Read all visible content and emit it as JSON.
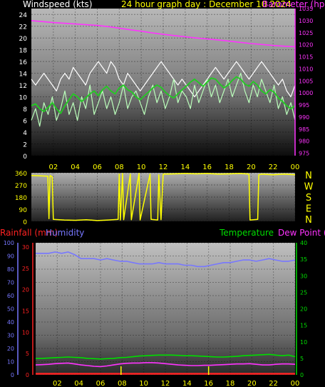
{
  "header": {
    "wind_title": "Windspeed (kts)",
    "graph_title": "24 hour graph day : December 10 2024",
    "baro_title": "Barometer (hpa)"
  },
  "colors": {
    "wind_text": "#ffffff",
    "baro": "#ff33ff",
    "gust": "#ffffff",
    "speed": "#bbffbb",
    "avg": "#22cc22",
    "direction": "#ffff00",
    "rain": "#ff2222",
    "humidity": "#7777ff",
    "temp": "#00dd00",
    "dewpoint": "#ff33ff"
  },
  "chart_data": [
    {
      "type": "line",
      "id": "wind_baro",
      "x_ticks": [
        "02",
        "04",
        "06",
        "08",
        "10",
        "12",
        "14",
        "16",
        "18",
        "20",
        "22",
        "00"
      ],
      "ylabel_left": "Windspeed (kts)",
      "ylabel_right": "Barometer (hpa)",
      "ylim_left": [
        0,
        25
      ],
      "left_ticks": [
        0,
        2,
        4,
        6,
        8,
        10,
        12,
        14,
        16,
        18,
        20,
        22,
        24
      ],
      "ylim_right": [
        974,
        1035
      ],
      "right_ticks": [
        975,
        980,
        985,
        990,
        995,
        1000,
        1005,
        1010,
        1015,
        1020,
        1025,
        1030,
        1035
      ],
      "series": [
        {
          "name": "Barometer (hpa)",
          "axis": "right",
          "values": [
            1030.0,
            1029.6,
            1029.2,
            1028.9,
            1028.6,
            1028.3,
            1028.0,
            1027.5,
            1026.9,
            1026.2,
            1025.6,
            1024.9,
            1024.3,
            1023.8,
            1023.3,
            1022.8,
            1022.4,
            1022.0,
            1021.5,
            1021.0,
            1020.5,
            1020.1,
            1019.7,
            1019.4,
            1019.2
          ]
        },
        {
          "name": "gust",
          "axis": "left",
          "values": [
            13,
            12,
            13,
            14,
            13,
            12,
            11,
            13,
            14,
            13,
            15,
            14,
            13,
            12,
            14,
            15,
            16,
            15,
            14,
            16,
            15,
            13,
            12,
            14,
            13,
            12,
            11,
            12,
            13,
            14,
            15,
            16,
            15,
            14,
            13,
            12,
            13,
            12,
            11,
            10,
            11,
            12,
            13,
            14,
            15,
            14,
            13,
            14,
            15,
            16,
            15,
            14,
            13,
            14,
            15,
            16,
            15,
            14,
            13,
            12,
            13,
            11,
            10,
            12
          ]
        },
        {
          "name": "speed",
          "axis": "left",
          "values": [
            6,
            8,
            5,
            9,
            7,
            10,
            6,
            8,
            11,
            7,
            9,
            6,
            10,
            8,
            12,
            7,
            9,
            11,
            8,
            10,
            7,
            9,
            12,
            8,
            10,
            11,
            9,
            7,
            10,
            12,
            9,
            11,
            8,
            10,
            13,
            9,
            11,
            10,
            8,
            12,
            9,
            11,
            13,
            10,
            12,
            9,
            11,
            13,
            10,
            12,
            14,
            11,
            9,
            12,
            10,
            13,
            11,
            9,
            12,
            8,
            10,
            7,
            9,
            6
          ]
        },
        {
          "name": "average",
          "axis": "left",
          "values": [
            8.5,
            8.8,
            8.0,
            7.5,
            8.2,
            9.0,
            8.0,
            7.2,
            8.5,
            9.5,
            10.5,
            10.0,
            9.2,
            9.8,
            10.5,
            11.0,
            10.2,
            11.2,
            11.8,
            11.0,
            10.5,
            11.5,
            12.0,
            11.2,
            10.8,
            10.0,
            9.5,
            10.2,
            10.8,
            11.5,
            12.0,
            11.6,
            10.8,
            10.2,
            9.8,
            10.5,
            11.2,
            11.8,
            12.5,
            13.0,
            12.4,
            11.8,
            12.5,
            13.2,
            13.0,
            12.2,
            11.5,
            12.0,
            12.8,
            13.4,
            13.0,
            12.2,
            11.8,
            12.6,
            12.0,
            11.0,
            10.5,
            11.2,
            10.8,
            9.8,
            9.2,
            8.5,
            8.0,
            8.5
          ]
        }
      ]
    },
    {
      "type": "line",
      "id": "direction",
      "x_ticks": [
        "02",
        "04",
        "06",
        "08",
        "10",
        "12",
        "14",
        "16",
        "18",
        "20",
        "22",
        "00"
      ],
      "ylim": [
        0,
        360
      ],
      "left_ticks": [
        0,
        90,
        180,
        270,
        360
      ],
      "compass_labels": [
        "N",
        "W",
        "S",
        "E",
        "N"
      ],
      "series": [
        {
          "name": "direction",
          "points": [
            [
              0,
              340
            ],
            [
              1.5,
              335
            ],
            [
              1.6,
              20
            ],
            [
              1.7,
              340
            ],
            [
              1.9,
              330
            ],
            [
              2.0,
              15
            ],
            [
              3.0,
              10
            ],
            [
              4.0,
              8
            ],
            [
              5.0,
              12
            ],
            [
              6.0,
              6
            ],
            [
              7.0,
              10
            ],
            [
              7.9,
              15
            ],
            [
              8.0,
              350
            ],
            [
              8.1,
              10
            ],
            [
              8.3,
              355
            ],
            [
              8.4,
              12
            ],
            [
              9.0,
              350
            ],
            [
              9.1,
              12
            ],
            [
              9.8,
              355
            ],
            [
              9.9,
              10
            ],
            [
              10.8,
              350
            ],
            [
              10.9,
              15
            ],
            [
              11.5,
              10
            ],
            [
              11.6,
              345
            ],
            [
              11.8,
              12
            ],
            [
              12.0,
              350
            ],
            [
              13.0,
              352
            ],
            [
              14.0,
              355
            ],
            [
              15.0,
              352
            ],
            [
              16.0,
              355
            ],
            [
              17.0,
              350
            ],
            [
              18.0,
              352
            ],
            [
              19.0,
              355
            ],
            [
              19.8,
              350
            ],
            [
              19.9,
              10
            ],
            [
              20.6,
              15
            ],
            [
              20.7,
              345
            ],
            [
              21.0,
              350
            ],
            [
              22.0,
              345
            ],
            [
              23.0,
              350
            ],
            [
              24.0,
              345
            ]
          ]
        }
      ]
    },
    {
      "type": "line",
      "id": "rain_hum_temp",
      "x_ticks": [
        "02",
        "04",
        "06",
        "08",
        "10",
        "12",
        "14",
        "16",
        "18",
        "20",
        "22",
        "00"
      ],
      "ylabel_rain": "Rainfall (mm)",
      "ylabel_humidity": "Humidity",
      "ylabel_temp": "Temperature",
      "ylabel_dew": "Dew Point (c)",
      "humidity_ticks": [
        0,
        10,
        20,
        30,
        40,
        50,
        60,
        70,
        80,
        90,
        100
      ],
      "rain_ticks": [
        0,
        5,
        10,
        15,
        20,
        25,
        30
      ],
      "temp_ticks": [
        0,
        5,
        10,
        15,
        20,
        25,
        30,
        35,
        40
      ],
      "series": [
        {
          "name": "Humidity",
          "axis": "humidity",
          "values": [
            92,
            92,
            92,
            93,
            92,
            93,
            91,
            88,
            88,
            88,
            87,
            88,
            87,
            86,
            86,
            85,
            84,
            84,
            84,
            85,
            84,
            84,
            84,
            83,
            83,
            82,
            82,
            83,
            84,
            85,
            85,
            86,
            87,
            87,
            86,
            87,
            88,
            87,
            86,
            86,
            87
          ]
        },
        {
          "name": "Temperature",
          "axis": "temp",
          "values": [
            5.0,
            5.0,
            5.1,
            5.2,
            5.3,
            5.4,
            5.3,
            5.2,
            5.0,
            4.9,
            4.8,
            4.9,
            5.0,
            5.2,
            5.3,
            5.5,
            5.7,
            5.8,
            5.9,
            6.0,
            6.0,
            6.0,
            5.9,
            5.8,
            5.8,
            5.7,
            5.6,
            5.5,
            5.4,
            5.4,
            5.5,
            5.6,
            5.8,
            5.9,
            6.0,
            6.1,
            6.2,
            6.0,
            5.8,
            6.0,
            5.5
          ]
        },
        {
          "name": "Dew Point (c)",
          "axis": "temp",
          "values": [
            3.0,
            3.1,
            3.2,
            3.4,
            3.5,
            3.6,
            3.3,
            3.0,
            2.8,
            2.6,
            2.5,
            2.7,
            3.0,
            3.3,
            3.5,
            3.6,
            3.6,
            3.7,
            3.7,
            3.6,
            3.4,
            3.2,
            3.0,
            2.9,
            2.8,
            2.8,
            2.9,
            2.9,
            3.0,
            3.1,
            3.2,
            3.3,
            3.3,
            3.4,
            3.2,
            3.0,
            3.0,
            3.2,
            3.3,
            3.3,
            3.2
          ]
        },
        {
          "name": "Rainfall (mm)",
          "axis": "rain",
          "values": [
            0,
            0,
            0,
            0,
            0,
            0,
            0,
            0,
            0,
            0,
            0,
            0,
            0,
            0,
            0,
            0,
            0,
            0,
            0,
            0,
            0,
            0,
            0,
            0,
            0,
            0,
            0,
            0,
            0,
            0,
            0,
            0,
            0,
            0,
            0,
            0,
            0,
            0,
            0,
            0,
            0
          ]
        }
      ],
      "rain_ticks_marks": [
        7.9,
        16.0
      ]
    }
  ]
}
